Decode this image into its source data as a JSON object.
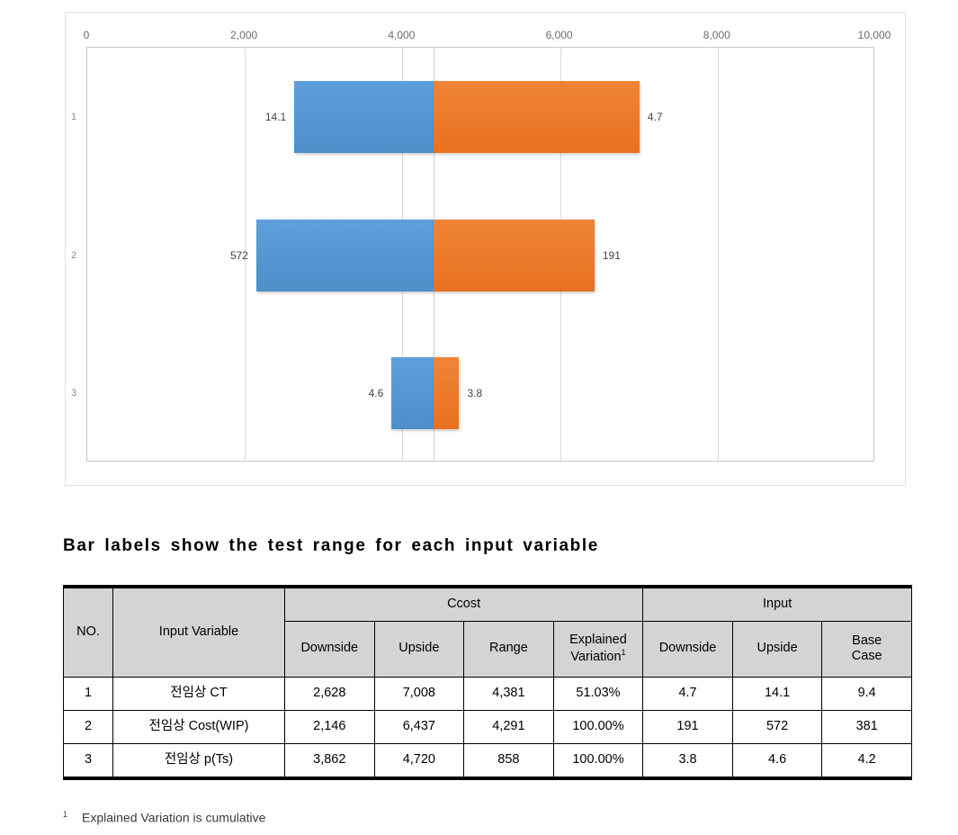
{
  "chart_data": {
    "type": "bar",
    "title": "",
    "subtitle": "",
    "orientation": "horizontal",
    "variant": "tornado",
    "xlabel": "",
    "ylabel": "",
    "xlim": [
      0,
      10000
    ],
    "x_ticks": [
      "0",
      "2,000",
      "4,000",
      "6,000",
      "8,000",
      "10,000"
    ],
    "x_tick_values": [
      0,
      2000,
      4000,
      6000,
      8000,
      10000
    ],
    "categories": [
      "1",
      "2",
      "3"
    ],
    "grid": true,
    "gridlines_at": [
      0,
      2000,
      4000,
      6000,
      8000,
      10000
    ],
    "base_case_line": 4400,
    "legend": [],
    "legend_position": "none",
    "series": [
      {
        "name": "Downside",
        "color": "#5B9BD5",
        "values": [
          2628,
          2146,
          3862
        ],
        "bar_labels": [
          "14.1",
          "572",
          "4.6"
        ],
        "label_side": "left"
      },
      {
        "name": "Upside",
        "color": "#ED7D31",
        "values": [
          7008,
          6437,
          4720
        ],
        "bar_labels": [
          "4.7",
          "191",
          "3.8"
        ],
        "label_side": "right"
      }
    ],
    "bars": [
      {
        "category": "1",
        "start": 2628,
        "split": 4400,
        "end": 7008,
        "left_label": "14.1",
        "right_label": "4.7"
      },
      {
        "category": "2",
        "start": 2146,
        "split": 4400,
        "end": 6437,
        "left_label": "572",
        "right_label": "191"
      },
      {
        "category": "3",
        "start": 3862,
        "split": 4400,
        "end": 4720,
        "left_label": "4.6",
        "right_label": "3.8"
      }
    ]
  },
  "caption": {
    "text": "Bar labels show the test range for each input variable"
  },
  "table": {
    "group_headers": {
      "no": "NO.",
      "input_variable": "Input Variable",
      "ccost": "Ccost",
      "input": "Input"
    },
    "sub_headers": {
      "ccost_downside": "Downside",
      "ccost_upside": "Upside",
      "ccost_range": "Range",
      "explained_variation": "Explained Variation",
      "explained_variation_sup": "1",
      "input_downside": "Downside",
      "input_upside": "Upside",
      "base_case_line1": "Base",
      "base_case_line2": "Case"
    },
    "rows": [
      {
        "no": "1",
        "variable": "전임상 CT",
        "ccost_downside": "2,628",
        "ccost_upside": "7,008",
        "ccost_range": "4,381",
        "explained_variation": "51.03%",
        "input_downside": "4.7",
        "input_upside": "14.1",
        "base_case": "9.4"
      },
      {
        "no": "2",
        "variable": "전임상 Cost(WIP)",
        "ccost_downside": "2,146",
        "ccost_upside": "6,437",
        "ccost_range": "4,291",
        "explained_variation": "100.00%",
        "input_downside": "191",
        "input_upside": "572",
        "base_case": "381"
      },
      {
        "no": "3",
        "variable": "전임상  p(Ts)",
        "ccost_downside": "3,862",
        "ccost_upside": "4,720",
        "ccost_range": "858",
        "explained_variation": "100.00%",
        "input_downside": "3.8",
        "input_upside": "4.6",
        "base_case": "4.2"
      }
    ]
  },
  "footnote": {
    "mark": "1",
    "text": "Explained Variation is cumulative"
  },
  "colors": {
    "downside_blue": "#5B9BD5",
    "upside_orange": "#ED7D31",
    "header_gray": "#D4D4D4",
    "gridline": "#D9D9D9",
    "axis_text": "#6B6B6B"
  }
}
